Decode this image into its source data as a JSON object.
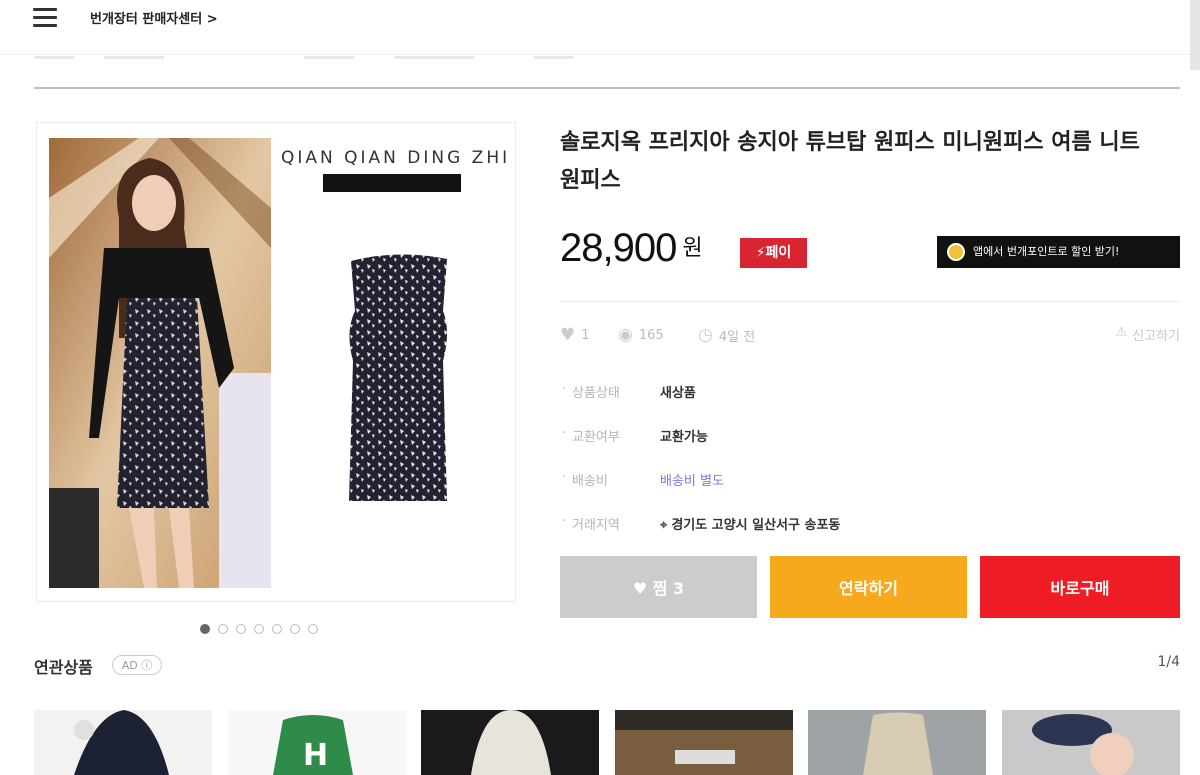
{
  "header": {
    "seller_center": "번개장터 판매자센터 >"
  },
  "gallery": {
    "brand_text": "QIAN  QIAN  DING  ZHI",
    "active_index": 1,
    "total_images": 7
  },
  "product": {
    "title": "솔로지옥 프리지아 송지아 튜브탑 원피스 미니원피스 여름 니트 원피스",
    "price": "28,900",
    "currency": "원",
    "pay_badge": "페이",
    "point_banner": "앱에서 번개포인트로 할인 받기!",
    "stats": {
      "likes": "1",
      "views": "165",
      "time": "4일 전",
      "report": "신고하기"
    },
    "info": [
      {
        "key": "상품상태",
        "value": "새상품"
      },
      {
        "key": "교환여부",
        "value": "교환가능"
      },
      {
        "key": "배송비",
        "value": "배송비 별도"
      },
      {
        "key": "거래지역",
        "value": "경기도 고양시 일산서구 송포동"
      }
    ],
    "buttons": {
      "like": "찜 3",
      "contact": "연락하기",
      "buy": "바로구매"
    }
  },
  "related": {
    "title": "연관상품",
    "ad_label": "AD ⓘ",
    "pager": "1/4"
  },
  "colors": {
    "pay_red": "#d92431",
    "contact_orange": "#f7a91d",
    "buy_red": "#ee1c24",
    "like_gray": "#cccccc"
  }
}
